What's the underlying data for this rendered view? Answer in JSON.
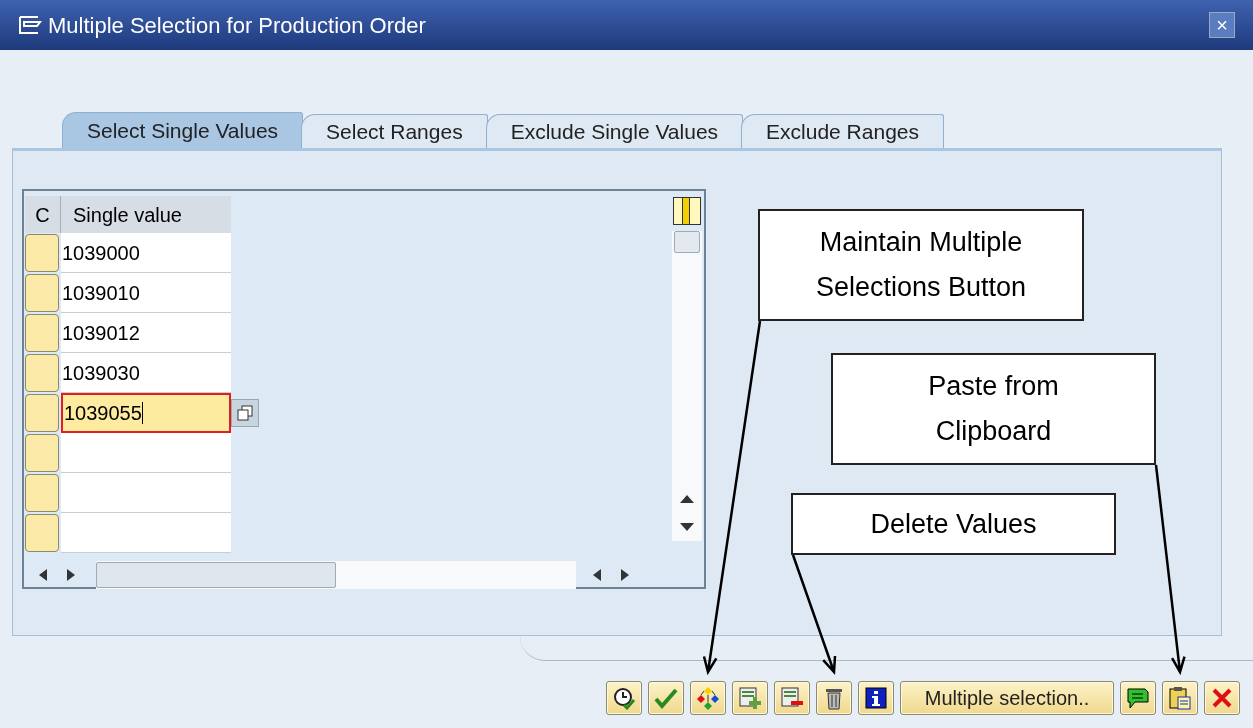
{
  "window": {
    "title": "Multiple Selection for Production Order",
    "close_label": "×"
  },
  "tabs": [
    {
      "label": "Select Single Values",
      "selected": true
    },
    {
      "label": "Select Ranges",
      "selected": false
    },
    {
      "label": "Exclude Single Values",
      "selected": false
    },
    {
      "label": "Exclude Ranges",
      "selected": false
    }
  ],
  "table": {
    "columns": [
      "C",
      "Single value"
    ],
    "rows": [
      {
        "value": "1039000",
        "focused": false
      },
      {
        "value": "1039010",
        "focused": false
      },
      {
        "value": "1039012",
        "focused": false
      },
      {
        "value": "1039030",
        "focused": false
      },
      {
        "value": "1039055",
        "focused": true
      },
      {
        "focused": false
      },
      {
        "focused": false
      },
      {
        "focused": false
      }
    ]
  },
  "toolbar": [
    {
      "kind": "clock"
    },
    {
      "kind": "check"
    },
    {
      "kind": "diamond"
    },
    {
      "kind": "add-row"
    },
    {
      "kind": "remove-row"
    },
    {
      "kind": "trash"
    },
    {
      "kind": "info"
    },
    {
      "kind": "text",
      "label": "Multiple selection.."
    },
    {
      "kind": "comment"
    },
    {
      "kind": "paste"
    },
    {
      "kind": "cancel"
    }
  ],
  "callouts": [
    {
      "text": "Maintain Multiple Selections Button"
    },
    {
      "text": "Paste from Clipboard"
    },
    {
      "text": "Delete Values"
    }
  ]
}
